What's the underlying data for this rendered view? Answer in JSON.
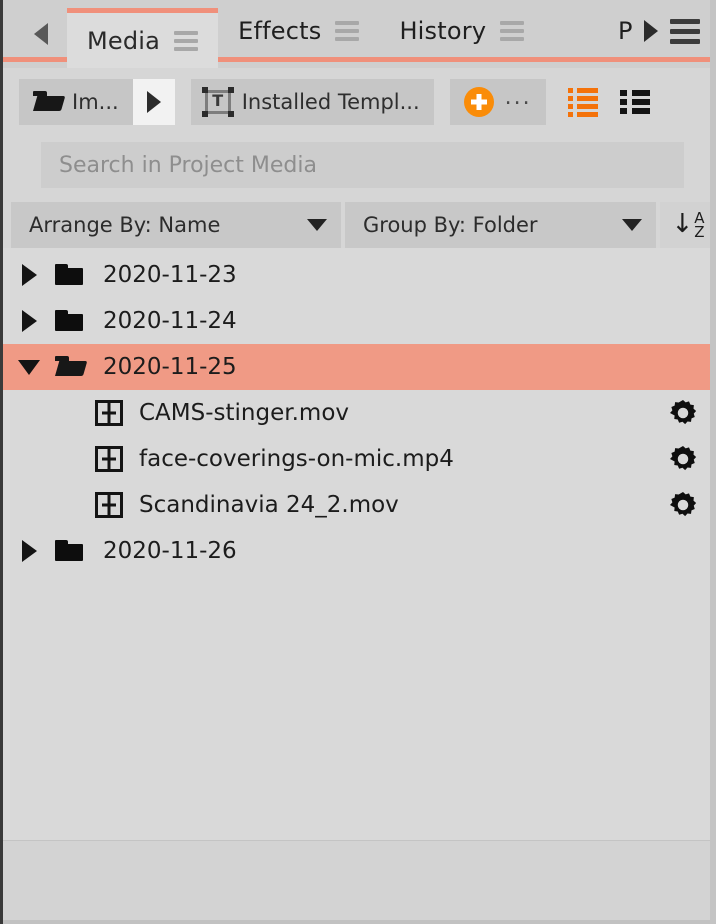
{
  "tabbar": {
    "scroll_left_icon": "triangle-left-icon",
    "scroll_right_icon": "triangle-right-icon",
    "panel_menu_icon": "hamburger-menu-icon",
    "tabs": [
      {
        "label": "Media",
        "active": true,
        "menu_icon": "tab-menu-icon"
      },
      {
        "label": "Effects",
        "active": false,
        "menu_icon": "tab-menu-icon"
      },
      {
        "label": "History",
        "active": false,
        "menu_icon": "tab-menu-icon"
      }
    ],
    "clipped_tab_label": "P"
  },
  "toolbar": {
    "import_button": {
      "label": "Im...",
      "icon": "folder-open-icon"
    },
    "play_button": {
      "icon": "triangle-right-icon"
    },
    "templates_button": {
      "label": "Installed Templ...",
      "icon": "title-template-icon"
    },
    "new_button": {
      "label": "...",
      "icon": "plus-circle-icon"
    },
    "list_view_button": {
      "icon": "list-view-icon",
      "active": true
    },
    "thumb_view_button": {
      "icon": "detail-view-icon",
      "active": false
    }
  },
  "search": {
    "placeholder": "Search in Project Media",
    "value": ""
  },
  "arrange": {
    "arrange_by_label": "Arrange By: Name",
    "group_by_label": "Group By: Folder",
    "sort_icon": "sort-a-to-z-icon"
  },
  "tree": {
    "rows": [
      {
        "type": "folder",
        "name": "2020-11-23",
        "expanded": false,
        "selected": false,
        "icon": "folder-closed-icon"
      },
      {
        "type": "folder",
        "name": "2020-11-24",
        "expanded": false,
        "selected": false,
        "icon": "folder-closed-icon"
      },
      {
        "type": "folder",
        "name": "2020-11-25",
        "expanded": true,
        "selected": true,
        "icon": "folder-open-icon"
      },
      {
        "type": "file",
        "name": "CAMS-stinger.mov",
        "icon": "film-clip-icon",
        "action_icon": "gear-icon"
      },
      {
        "type": "file",
        "name": "face-coverings-on-mic.mp4",
        "icon": "film-clip-icon",
        "action_icon": "gear-icon"
      },
      {
        "type": "file",
        "name": "Scandinavia 24_2.mov",
        "icon": "film-clip-icon",
        "action_icon": "gear-icon"
      },
      {
        "type": "folder",
        "name": "2020-11-26",
        "expanded": false,
        "selected": false,
        "icon": "folder-closed-icon"
      }
    ]
  },
  "colors": {
    "accent_salmon": "#f0907b",
    "selection_salmon": "#f09a85",
    "accent_orange": "#fa8c08",
    "panel_bg": "#d6d6d6",
    "tree_bg": "#d9d9d9"
  }
}
